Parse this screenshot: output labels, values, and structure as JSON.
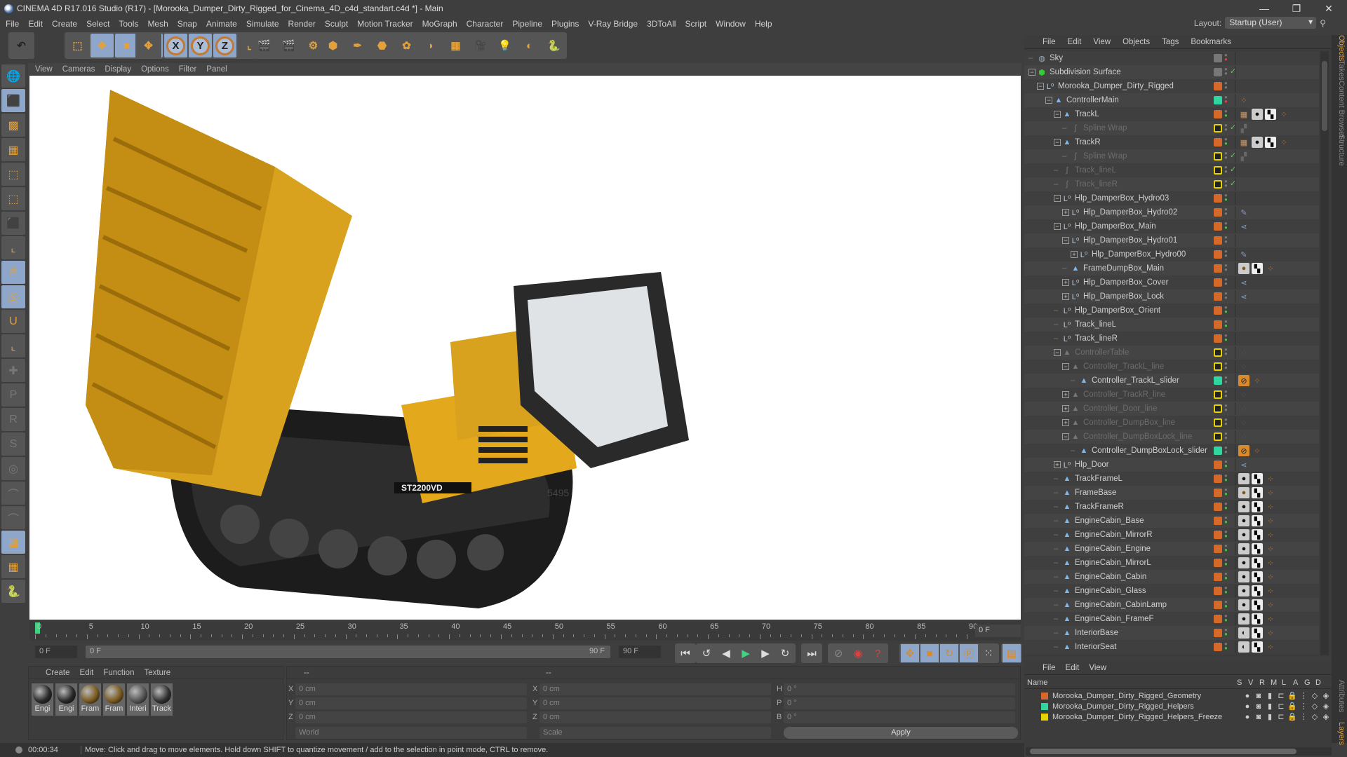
{
  "window": {
    "title": "CINEMA 4D R17.016 Studio (R17) - [Morooka_Dumper_Dirty_Rigged_for_Cinema_4D_c4d_standart.c4d *] - Main",
    "minimize": "—",
    "maximize": "❐",
    "close": "✕"
  },
  "menu": [
    "File",
    "Edit",
    "Create",
    "Select",
    "Tools",
    "Mesh",
    "Snap",
    "Animate",
    "Simulate",
    "Render",
    "Sculpt",
    "Motion Tracker",
    "MoGraph",
    "Character",
    "Pipeline",
    "Plugins",
    "V-Ray Bridge",
    "3DToAll",
    "Script",
    "Window",
    "Help"
  ],
  "layout": {
    "label": "Layout:",
    "value": "Startup (User)"
  },
  "toolbar": {
    "icons": [
      "undo-icon",
      "redo-icon",
      "live-selection-icon",
      "move-icon",
      "scale-icon",
      "rotate-icon",
      "recent-tool-icon",
      "x-axis-icon",
      "y-axis-icon",
      "z-axis-icon",
      "coordinate-system-icon",
      "render-view-icon",
      "render-picture-viewer-icon",
      "edit-render-settings-icon",
      "cube-icon",
      "pen-icon",
      "subdivision-icon",
      "mograph-cloner-icon",
      "deformer-icon",
      "floor-icon",
      "camera-icon",
      "light-icon",
      "vray-icon",
      "python-icon"
    ],
    "x": "X",
    "y": "Y",
    "z": "Z"
  },
  "lefttools": [
    "make-editable-icon",
    "model-mode-icon",
    "texture-mode-icon",
    "workplane-icon",
    "points-mode-icon",
    "edges-mode-icon",
    "polygons-mode-icon",
    "axis-mode-icon",
    "tweak-mode-icon",
    "solo-icon",
    "snap-icon",
    "workplane-axis-icon",
    "add-key-icon",
    "key-p-icon",
    "key-r-icon",
    "key-psr-icon",
    "key-point-icon",
    "key-param-icon",
    "key-pla-icon",
    "lock-workplane-icon",
    "workplane-sync-icon",
    "python-icon"
  ],
  "viewport": {
    "menu": [
      "View",
      "Cameras",
      "Display",
      "Options",
      "Filter",
      "Panel"
    ],
    "truck_label": "ST2200VD",
    "truck_number": "5495"
  },
  "timeline": {
    "ticks": [
      0,
      5,
      10,
      15,
      20,
      25,
      30,
      35,
      40,
      45,
      50,
      55,
      60,
      65,
      70,
      75,
      80,
      85,
      90
    ],
    "current_frame": "0 F",
    "start": "0 F",
    "range_start": "0 F",
    "range_end": "90 F",
    "end": "90 F",
    "playhead": 0
  },
  "materials": {
    "menu": [
      "Create",
      "Edit",
      "Function",
      "Texture"
    ],
    "items": [
      {
        "name": "Engi",
        "color": "#2a2a2a"
      },
      {
        "name": "Engi",
        "color": "#2a2a2a"
      },
      {
        "name": "Fram",
        "color": "#7a5a20"
      },
      {
        "name": "Fram",
        "color": "#7a5a20"
      },
      {
        "name": "Interi",
        "color": "#555"
      },
      {
        "name": "Track",
        "color": "#333"
      }
    ]
  },
  "coords": {
    "header_left": "--",
    "header_right": "--",
    "pos": [
      {
        "axis": "X",
        "value": "0 cm"
      },
      {
        "axis": "Y",
        "value": "0 cm"
      },
      {
        "axis": "Z",
        "value": "0 cm"
      }
    ],
    "size": [
      {
        "axis": "X",
        "value": "0 cm"
      },
      {
        "axis": "Y",
        "value": "0 cm"
      },
      {
        "axis": "Z",
        "value": "0 cm"
      }
    ],
    "rot": [
      {
        "axis": "H",
        "value": "0 °"
      },
      {
        "axis": "P",
        "value": "0 °"
      },
      {
        "axis": "B",
        "value": "0 °"
      }
    ],
    "space": "World",
    "mode": "Scale",
    "apply": "Apply"
  },
  "status": {
    "time": "00:00:34",
    "message": "Move: Click and drag to move elements. Hold down SHIFT to quantize movement / add to the selection in point mode, CTRL to remove."
  },
  "objects": {
    "menu": [
      "File",
      "Edit",
      "View",
      "Objects",
      "Tags",
      "Bookmarks"
    ],
    "rows": [
      {
        "name": "Sky",
        "level": 0,
        "icon": "sky",
        "color": "#777",
        "dot": "#e04040"
      },
      {
        "name": "Subdivision Surface",
        "level": 0,
        "icon": "subdiv",
        "exp": "-",
        "color": "#777",
        "check": true
      },
      {
        "name": "Morooka_Dumper_Dirty_Rigged",
        "level": 1,
        "icon": "null",
        "exp": "-",
        "color": "#d4692a"
      },
      {
        "name": "ControllerMain",
        "level": 2,
        "icon": "joint",
        "exp": "-",
        "color": "#2fd6a0",
        "dot": "#e04040",
        "tags": [
          "ik"
        ]
      },
      {
        "name": "TrackL",
        "level": 3,
        "icon": "joint",
        "exp": "-",
        "color": "#d4692a",
        "dot": "#3c3",
        "tags": [
          "uv",
          "mat-dark",
          "checker",
          "ik"
        ]
      },
      {
        "name": "Spline Wrap",
        "level": 4,
        "icon": "spline",
        "dim": true,
        "color": "#e6d200",
        "check": true,
        "tags": [
          "layers"
        ]
      },
      {
        "name": "TrackR",
        "level": 3,
        "icon": "joint",
        "exp": "-",
        "color": "#d4692a",
        "dot": "#3c3",
        "tags": [
          "uv",
          "mat-dark",
          "checker",
          "ik"
        ]
      },
      {
        "name": "Spline Wrap",
        "level": 4,
        "icon": "spline",
        "dim": true,
        "color": "#e6d200",
        "check": true,
        "tags": [
          "layers"
        ]
      },
      {
        "name": "Track_lineL",
        "level": 3,
        "icon": "spline",
        "dim": true,
        "color": "#e6d200",
        "check": true
      },
      {
        "name": "Track_lineR",
        "level": 3,
        "icon": "spline",
        "dim": true,
        "color": "#e6d200",
        "check": true
      },
      {
        "name": "Hlp_DamperBox_Hydro03",
        "level": 3,
        "icon": "null",
        "exp": "-",
        "color": "#d4692a",
        "dot": "#3c3"
      },
      {
        "name": "Hlp_DamperBox_Hydro02",
        "level": 4,
        "icon": "null",
        "exp": "+",
        "color": "#d4692a",
        "tags": [
          "pin"
        ]
      },
      {
        "name": "Hlp_DamperBox_Main",
        "level": 3,
        "icon": "null",
        "exp": "-",
        "color": "#d4692a",
        "dot": "#3c3",
        "tags": [
          "tree"
        ]
      },
      {
        "name": "Hlp_DamperBox_Hydro01",
        "level": 4,
        "icon": "null",
        "exp": "-",
        "color": "#d4692a"
      },
      {
        "name": "Hlp_DamperBox_Hydro00",
        "level": 5,
        "icon": "null",
        "exp": "+",
        "color": "#d4692a",
        "tags": [
          "pin"
        ]
      },
      {
        "name": "FrameDumpBox_Main",
        "level": 4,
        "icon": "joint",
        "color": "#d4692a",
        "tags": [
          "mat-gold",
          "checker",
          "ik"
        ]
      },
      {
        "name": "Hlp_DamperBox_Cover",
        "level": 4,
        "icon": "null",
        "exp": "+",
        "color": "#d4692a",
        "tags": [
          "tree"
        ]
      },
      {
        "name": "Hlp_DamperBox_Lock",
        "level": 4,
        "icon": "null",
        "exp": "+",
        "color": "#d4692a",
        "tags": [
          "tree"
        ]
      },
      {
        "name": "Hlp_DamperBox_Orient",
        "level": 3,
        "icon": "null",
        "color": "#d4692a",
        "dot": "#3c3"
      },
      {
        "name": "Track_lineL",
        "level": 3,
        "icon": "null",
        "color": "#d4692a",
        "dot": "#3c3"
      },
      {
        "name": "Track_lineR",
        "level": 3,
        "icon": "null",
        "color": "#d4692a",
        "dot": "#3c3"
      },
      {
        "name": "ControllerTable",
        "level": 3,
        "icon": "joint",
        "exp": "-",
        "dim": true,
        "color": "#e6d200",
        "tags": [
          "ik-dim"
        ]
      },
      {
        "name": "Controller_TrackL_line",
        "level": 4,
        "icon": "joint",
        "exp": "-",
        "dim": true,
        "color": "#e6d200",
        "tags": [
          "ik-dim"
        ]
      },
      {
        "name": "Controller_TrackL_slider",
        "level": 5,
        "icon": "joint",
        "color": "#2fd6a0",
        "tags": [
          "forbid",
          "ik"
        ]
      },
      {
        "name": "Controller_TrackR_line",
        "level": 4,
        "icon": "joint",
        "exp": "+",
        "dim": true,
        "color": "#e6d200",
        "tags": [
          "ik-dim"
        ]
      },
      {
        "name": "Controller_Door_line",
        "level": 4,
        "icon": "joint",
        "exp": "+",
        "dim": true,
        "color": "#e6d200",
        "tags": [
          "ik-dim"
        ]
      },
      {
        "name": "Controller_DumpBox_line",
        "level": 4,
        "icon": "joint",
        "exp": "+",
        "dim": true,
        "color": "#e6d200",
        "tags": [
          "ik-dim"
        ]
      },
      {
        "name": "Controller_DumpBoxLock_line",
        "level": 4,
        "icon": "joint",
        "exp": "-",
        "dim": true,
        "color": "#e6d200",
        "tags": [
          "ik-dim"
        ]
      },
      {
        "name": "Controller_DumpBoxLock_slider",
        "level": 5,
        "icon": "joint",
        "color": "#2fd6a0",
        "tags": [
          "forbid",
          "ik"
        ]
      },
      {
        "name": "Hlp_Door",
        "level": 3,
        "icon": "null",
        "exp": "+",
        "color": "#d4692a",
        "dot": "#3c3",
        "tags": [
          "tree"
        ]
      },
      {
        "name": "TrackFrameL",
        "level": 3,
        "icon": "joint",
        "color": "#d4692a",
        "dot": "#3c3",
        "tags": [
          "mat-dark",
          "checker",
          "ik"
        ]
      },
      {
        "name": "FrameBase",
        "level": 3,
        "icon": "joint",
        "color": "#d4692a",
        "dot": "#3c3",
        "tags": [
          "mat-gold",
          "checker",
          "ik"
        ]
      },
      {
        "name": "TrackFrameR",
        "level": 3,
        "icon": "joint",
        "color": "#d4692a",
        "dot": "#3c3",
        "tags": [
          "mat-dark",
          "checker",
          "ik"
        ]
      },
      {
        "name": "EngineCabin_Base",
        "level": 3,
        "icon": "joint",
        "color": "#d4692a",
        "dot": "#3c3",
        "tags": [
          "mat-dark",
          "checker",
          "ik"
        ]
      },
      {
        "name": "EngineCabin_MirrorR",
        "level": 3,
        "icon": "joint",
        "color": "#d4692a",
        "dot": "#3c3",
        "tags": [
          "mat-dark",
          "checker",
          "ik"
        ]
      },
      {
        "name": "EngineCabin_Engine",
        "level": 3,
        "icon": "joint",
        "color": "#d4692a",
        "dot": "#3c3",
        "tags": [
          "mat-dark",
          "checker",
          "ik"
        ]
      },
      {
        "name": "EngineCabin_MirrorL",
        "level": 3,
        "icon": "joint",
        "color": "#d4692a",
        "dot": "#3c3",
        "tags": [
          "mat-dark",
          "checker",
          "ik"
        ]
      },
      {
        "name": "EngineCabin_Cabin",
        "level": 3,
        "icon": "joint",
        "color": "#d4692a",
        "dot": "#3c3",
        "tags": [
          "mat-dark",
          "checker",
          "ik"
        ]
      },
      {
        "name": "EngineCabin_Glass",
        "level": 3,
        "icon": "joint",
        "color": "#d4692a",
        "dot": "#3c3",
        "tags": [
          "mat-dark",
          "checker",
          "ik"
        ]
      },
      {
        "name": "EngineCabin_CabinLamp",
        "level": 3,
        "icon": "joint",
        "color": "#d4692a",
        "dot": "#3c3",
        "tags": [
          "mat-dark",
          "checker",
          "ik"
        ]
      },
      {
        "name": "EngineCabin_FrameF",
        "level": 3,
        "icon": "joint",
        "color": "#d4692a",
        "dot": "#3c3",
        "tags": [
          "mat-dark",
          "checker",
          "ik"
        ]
      },
      {
        "name": "InteriorBase",
        "level": 3,
        "icon": "joint",
        "color": "#d4692a",
        "dot": "#3c3",
        "tags": [
          "mat-interior",
          "checker",
          "ik"
        ]
      },
      {
        "name": "InteriorSeat",
        "level": 3,
        "icon": "joint",
        "color": "#d4692a",
        "dot": "#3c3",
        "tags": [
          "mat-interior",
          "checker",
          "ik"
        ]
      }
    ]
  },
  "layers": {
    "menu": [
      "File",
      "Edit",
      "View"
    ],
    "columns": [
      "Name",
      "S",
      "V",
      "R",
      "M",
      "L",
      "A",
      "G",
      "D"
    ],
    "rows": [
      {
        "name": "Morooka_Dumper_Dirty_Rigged_Geometry",
        "color": "#d4692a"
      },
      {
        "name": "Morooka_Dumper_Dirty_Rigged_Helpers",
        "color": "#2fd6a0"
      },
      {
        "name": "Morooka_Dumper_Dirty_Rigged_Helpers_Freeze",
        "color": "#e6d200"
      }
    ]
  },
  "sidetabs": [
    "Objects",
    "Takes",
    "Content Browser",
    "Structure",
    "Attributes",
    "Layers"
  ],
  "colors": {
    "accent": "#8ea6c9",
    "orange": "#d98a2b",
    "panel": "#3c3c3c"
  }
}
